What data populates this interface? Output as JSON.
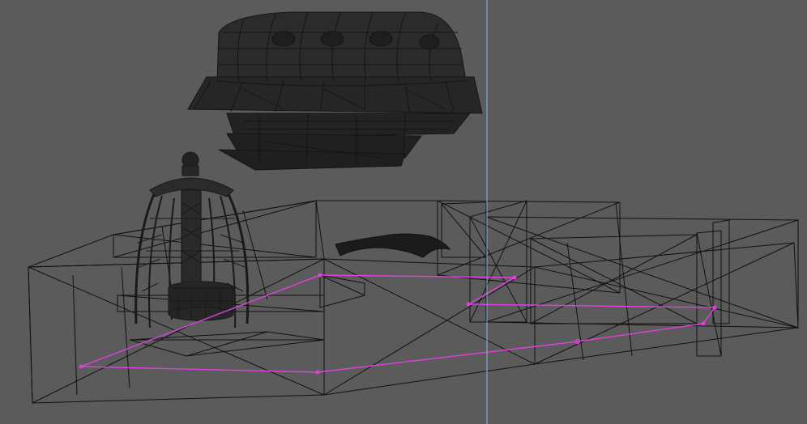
{
  "viewport": {
    "kind": "3d-wireframe-viewport",
    "background": "#5b5b5b",
    "wire_color": "#111111",
    "dense_mesh_color": "#1c1c1c",
    "selection_color": "#e040e0",
    "guide_line_color": "#8fb8e8",
    "objects": [
      "airship-wireframe-mesh",
      "tower-figure-wireframe-mesh",
      "floor-slab-wireframe",
      "wall-blocks-wireframe",
      "cloth-mesh",
      "selection-polygon",
      "vertical-guide-line"
    ]
  }
}
